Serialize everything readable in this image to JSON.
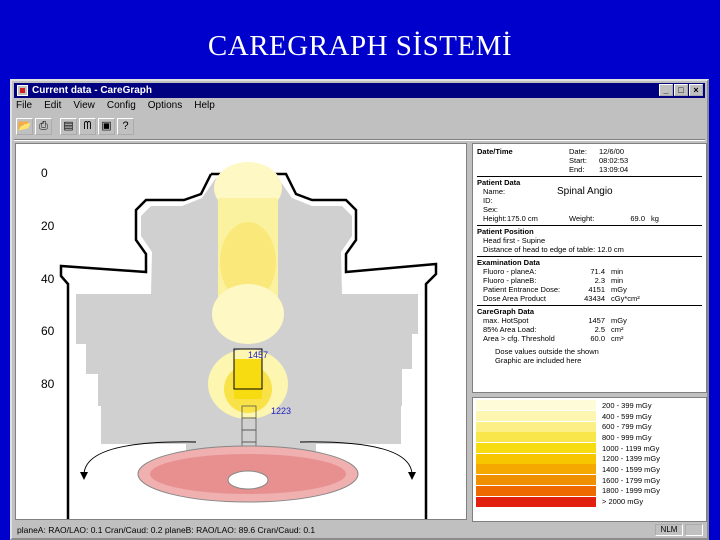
{
  "slide": {
    "title": "CAREGRAPH SİSTEMİ"
  },
  "window": {
    "title": "Current data - CareGraph",
    "buttons": [
      "_",
      "□",
      "×"
    ]
  },
  "menu": [
    "File",
    "Edit",
    "View",
    "Config",
    "Options",
    "Help"
  ],
  "toolbar": [
    {
      "icon": "open-folder-icon",
      "glyph": "📂"
    },
    {
      "icon": "print-icon",
      "glyph": "⎙"
    },
    {
      "icon": "layout-icon",
      "glyph": "▤"
    },
    {
      "icon": "logo-icon",
      "glyph": "ᗰ"
    },
    {
      "icon": "monitor-icon",
      "glyph": "▣"
    },
    {
      "icon": "help-icon",
      "glyph": "?"
    }
  ],
  "body_map": {
    "y_ticks": [
      "0",
      "20",
      "40",
      "60",
      "80"
    ],
    "dose_labels": [
      "1457",
      "1223"
    ]
  },
  "datetime": {
    "title": "Date/Time",
    "rows": [
      {
        "label": "Date:",
        "value": "12/6/00"
      },
      {
        "label": "Start:",
        "value": "08:02:53"
      },
      {
        "label": "End:",
        "value": "13:09:04"
      }
    ]
  },
  "patient": {
    "title": "Patient Data",
    "name_label": "Name:",
    "name_value": "Spinal Angio",
    "id_label": "ID:",
    "sex_label": "Sex:",
    "height_label": "Height:",
    "height_value": "175.0 cm",
    "weight_label": "Weight:",
    "weight_value": "69.0",
    "weight_unit": "kg"
  },
  "position": {
    "title": "Patient Position",
    "line1": "Head first - Supine",
    "line2": "Distance of head to edge of table: 12.0   cm"
  },
  "exam": {
    "title": "Examination Data",
    "rows": [
      {
        "label": "Fluoro - planeA:",
        "value": "71.4",
        "unit": "min"
      },
      {
        "label": "Fluoro - planeB:",
        "value": "2.3",
        "unit": "min"
      },
      {
        "label": "Patient Entrance Dose:",
        "value": "4151",
        "unit": "mGy"
      },
      {
        "label": "Dose Area Product",
        "value": "43434",
        "unit": "cGy*cm²"
      }
    ]
  },
  "caregraph": {
    "title": "CareGraph Data",
    "rows": [
      {
        "label": "max. HotSpot",
        "value": "1457",
        "unit": "mGy"
      },
      {
        "label": "85% Area Load:",
        "value": "2.5",
        "unit": "cm²"
      },
      {
        "label": "Area > cfg. Threshold",
        "value": "60.0",
        "unit": "cm²"
      }
    ],
    "note_line1": "Dose values outside the shown",
    "note_line2": "Graphic are included here"
  },
  "legend": [
    {
      "range": "200 -  399 mGy",
      "color": "#fdfbd8"
    },
    {
      "range": "400 -  599 mGy",
      "color": "#fcf6b0"
    },
    {
      "range": "600 -  799 mGy",
      "color": "#fbef86"
    },
    {
      "range": "800 -  999 mGy",
      "color": "#f9e64a"
    },
    {
      "range": "1000 - 1199 mGy",
      "color": "#f6dc10"
    },
    {
      "range": "1200 - 1399 mGy",
      "color": "#f7c600"
    },
    {
      "range": "1400 - 1599 mGy",
      "color": "#f5a800"
    },
    {
      "range": "1600 - 1799 mGy",
      "color": "#f08f00"
    },
    {
      "range": "1800 - 1999 mGy",
      "color": "#ee6a00"
    },
    {
      "range": "> 2000 mGy",
      "color": "#e22010"
    }
  ],
  "status": {
    "text": "planeA:   RAO/LAO: 0.1   Cran/Caud: 0.2      planeB:   RAO/LAO: 89.6   Cran/Caud: 0.1",
    "nlm": "NLM"
  }
}
